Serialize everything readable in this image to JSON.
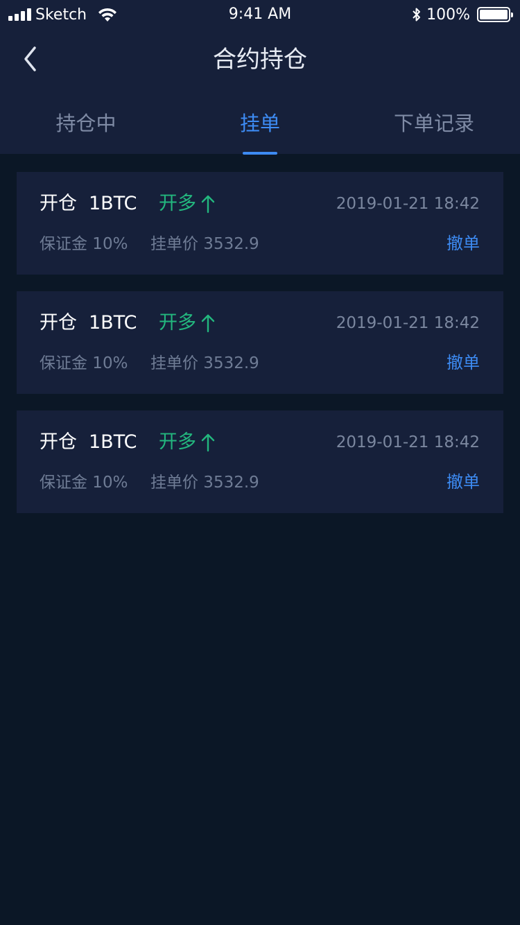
{
  "status_bar": {
    "carrier": "Sketch",
    "time": "9:41 AM",
    "battery": "100%"
  },
  "nav": {
    "title": "合约持仓",
    "back_icon": "chevron-left-icon"
  },
  "tabs": [
    {
      "label": "持仓中",
      "active": false
    },
    {
      "label": "挂单",
      "active": true
    },
    {
      "label": "下单记录",
      "active": false
    }
  ],
  "orders": [
    {
      "action": "开仓",
      "quantity": "1BTC",
      "direction": "开多",
      "direction_icon": "arrow-up-icon",
      "time": "2019-01-21 18:42",
      "margin": "保证金 10%",
      "price": "挂单价 3532.9",
      "cancel": "撤单"
    },
    {
      "action": "开仓",
      "quantity": "1BTC",
      "direction": "开多",
      "direction_icon": "arrow-up-icon",
      "time": "2019-01-21 18:42",
      "margin": "保证金 10%",
      "price": "挂单价 3532.9",
      "cancel": "撤单"
    },
    {
      "action": "开仓",
      "quantity": "1BTC",
      "direction": "开多",
      "direction_icon": "arrow-up-icon",
      "time": "2019-01-21 18:42",
      "margin": "保证金 10%",
      "price": "挂单价 3532.9",
      "cancel": "撤单"
    }
  ],
  "colors": {
    "background": "#0b1726",
    "card": "#16203a",
    "accent": "#3d8bf3",
    "long": "#23b77e"
  }
}
